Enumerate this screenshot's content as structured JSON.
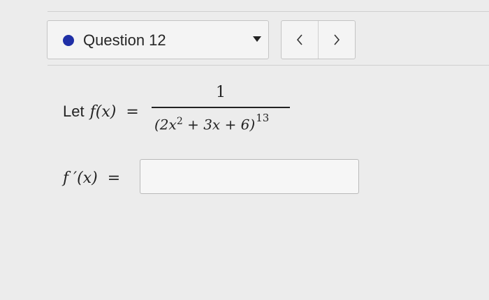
{
  "header": {
    "question_label": "Question 12",
    "prev_symbol": "<",
    "next_symbol": ">",
    "status_color": "#1f2fa6"
  },
  "problem": {
    "intro": "Let",
    "lhs": "f(x)",
    "equals": "=",
    "numerator": "1",
    "denominator_base": "(2x",
    "denominator_inner_exponent": "2",
    "denominator_rest": " + 3x + 6)",
    "denominator_outer_exponent": "13"
  },
  "answer": {
    "lhs": "f ′(x)",
    "equals": "=",
    "value": ""
  }
}
